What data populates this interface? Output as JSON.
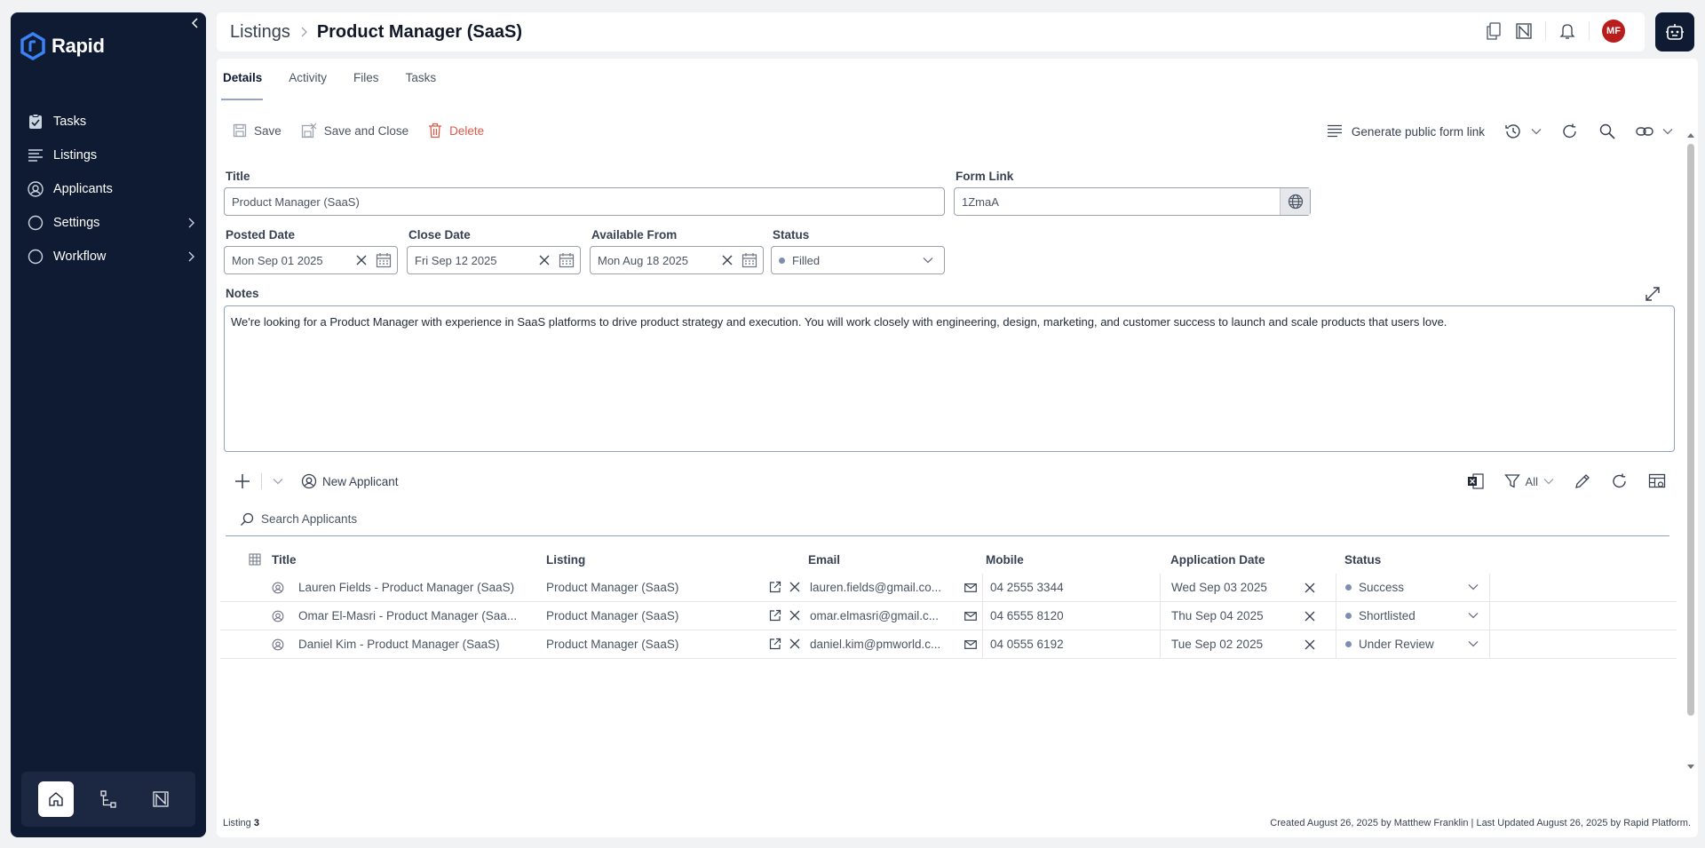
{
  "app": {
    "name": "Rapid",
    "accent": "#0f1b33",
    "brand_blue": "#3b82f6"
  },
  "sidebar": {
    "items": [
      {
        "label": "Tasks",
        "icon": "clipboard-icon"
      },
      {
        "label": "Listings",
        "icon": "list-icon"
      },
      {
        "label": "Applicants",
        "icon": "user-circle-icon"
      },
      {
        "label": "Settings",
        "icon": "circle-icon",
        "has_children": true
      },
      {
        "label": "Workflow",
        "icon": "circle-icon",
        "has_children": true
      }
    ],
    "bottom": [
      "home-icon",
      "flow-icon",
      "document-icon"
    ]
  },
  "header": {
    "breadcrumb_root": "Listings",
    "title": "Product Manager (SaaS)",
    "avatar_initials": "MF"
  },
  "tabs": [
    "Details",
    "Activity",
    "Files",
    "Tasks"
  ],
  "toolbar": {
    "save": "Save",
    "save_close": "Save and Close",
    "delete": "Delete",
    "generate_link": "Generate public form link"
  },
  "form": {
    "title_label": "Title",
    "title_value": "Product Manager (SaaS)",
    "form_link_label": "Form Link",
    "form_link_value": "1ZmaA",
    "posted_label": "Posted Date",
    "posted_value": "Mon Sep 01 2025",
    "close_label": "Close Date",
    "close_value": "Fri Sep 12 2025",
    "available_label": "Available From",
    "available_value": "Mon Aug 18 2025",
    "status_label": "Status",
    "status_value": "Filled",
    "notes_label": "Notes",
    "notes_value": "We're looking for a Product Manager with experience in SaaS platforms to drive product strategy and execution. You will work closely with engineering, design, marketing, and customer success to launch and scale products that users love."
  },
  "grid": {
    "new_applicant": "New Applicant",
    "filter": "All",
    "search_placeholder": "Search Applicants",
    "columns": [
      "Title",
      "Listing",
      "Email",
      "Mobile",
      "Application Date",
      "Status"
    ],
    "rows": [
      {
        "title": "Lauren Fields - Product Manager (SaaS)",
        "listing": "Product Manager (SaaS)",
        "email": "lauren.fields@gmail.co...",
        "mobile": "04 2555 3344",
        "date": "Wed Sep 03 2025",
        "status": "Success"
      },
      {
        "title": "Omar El-Masri - Product Manager (Saa...",
        "listing": "Product Manager (SaaS)",
        "email": "omar.elmasri@gmail.c...",
        "mobile": "04 6555 8120",
        "date": "Thu Sep 04 2025",
        "status": "Shortlisted"
      },
      {
        "title": "Daniel Kim - Product Manager (SaaS)",
        "listing": "Product Manager (SaaS)",
        "email": "daniel.kim@pmworld.c...",
        "mobile": "04 0555 6192",
        "date": "Tue Sep 02 2025",
        "status": "Under Review"
      }
    ]
  },
  "footer": {
    "left_label": "Listing",
    "left_value": "3",
    "right": "Created August 26, 2025 by Matthew Franklin | Last Updated August 26, 2025 by Rapid Platform."
  }
}
